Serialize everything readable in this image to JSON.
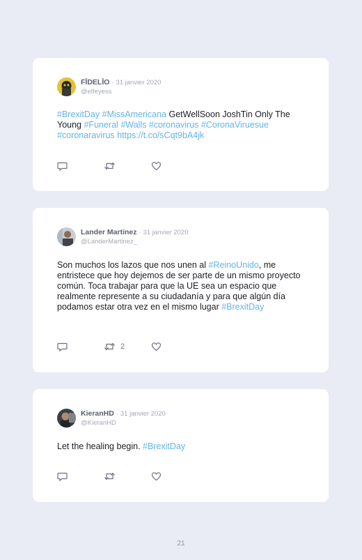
{
  "tweets": [
    {
      "author": "FĪDELĪO",
      "date": "31 janvier 2020",
      "handle": "@elfeyess",
      "avatar_icon": "avatar-fidelio",
      "parts": [
        {
          "text": "#BrexitDay",
          "tag": true
        },
        {
          "text": " ",
          "tag": false
        },
        {
          "text": "#MissAmericana",
          "tag": true
        },
        {
          "text": " GetWellSoon JoshTin Only The Young ",
          "tag": false
        },
        {
          "text": "#Funeral",
          "tag": true
        },
        {
          "text": " ",
          "tag": false
        },
        {
          "text": "#Walls",
          "tag": true
        },
        {
          "text": " ",
          "tag": false
        },
        {
          "text": "#coronavirus",
          "tag": true
        },
        {
          "text": " ",
          "tag": false
        },
        {
          "text": "#CoronaViruesue",
          "tag": true
        },
        {
          "text": " ",
          "tag": false
        },
        {
          "text": "#coronaravirus",
          "tag": true
        },
        {
          "text": " ",
          "tag": false
        },
        {
          "text": "https://t.co/sCqt9bA4jk",
          "tag": true
        }
      ],
      "retweets": "",
      "likes": ""
    },
    {
      "author": "Lander Martinez",
      "date": "31 janvier 2020",
      "handle": "@LanderMartinez_",
      "avatar_icon": "avatar-lander",
      "parts": [
        {
          "text": "Son muchos los lazos que nos unen al ",
          "tag": false
        },
        {
          "text": "#ReinoUnido",
          "tag": true
        },
        {
          "text": ", me entristece que hoy dejemos de ser parte de un mismo proyecto común. Toca trabajar para que la UE sea un espacio que realmente represente a su ciudadanía y para que algún día podamos estar otra vez en el mismo lugar ",
          "tag": false
        },
        {
          "text": "#BrexitDay",
          "tag": true
        }
      ],
      "retweets": "2",
      "likes": ""
    },
    {
      "author": "KieranHD",
      "date": "31 janvier 2020",
      "handle": "@KieranHD",
      "avatar_icon": "avatar-kieran",
      "parts": [
        {
          "text": "Let the healing begin. ",
          "tag": false
        },
        {
          "text": "#BrexitDay",
          "tag": true
        }
      ],
      "retweets": "",
      "likes": ""
    }
  ],
  "separator": "·",
  "page_number": "21",
  "colors": {
    "background": "#e9ebf5",
    "card": "#ffffff",
    "hashtag": "#63b3ea",
    "text": "#1c1e24",
    "muted": "#a3a8b6",
    "icon": "#6b7080"
  },
  "icons": [
    "reply-icon",
    "retweet-icon",
    "like-icon"
  ]
}
